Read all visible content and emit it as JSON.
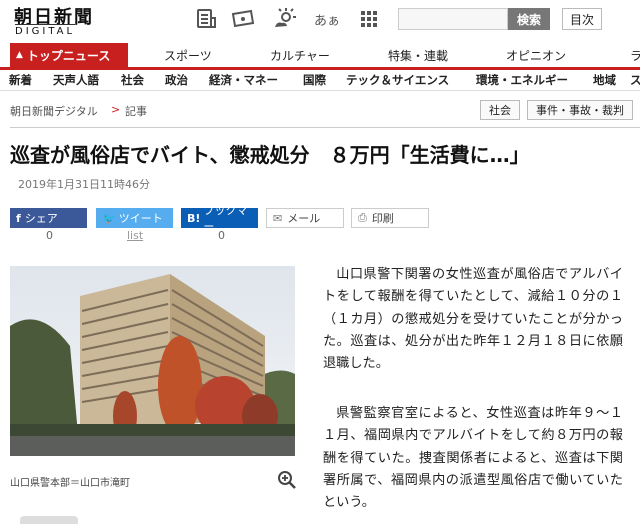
{
  "header": {
    "logo_main": "朝日新聞",
    "logo_sub": "DIGITAL",
    "search_placeholder": "",
    "search_label": "検索",
    "toc_label": "目次",
    "font_size_label": "あぁ"
  },
  "nav_primary": [
    {
      "label": "トップニュース",
      "active": true
    },
    {
      "label": "スポーツ"
    },
    {
      "label": "カルチャー"
    },
    {
      "label": "特集・連載"
    },
    {
      "label": "オピニオン"
    },
    {
      "label": "ラ"
    }
  ],
  "nav_secondary": [
    "新着",
    "天声人語",
    "社会",
    "政治",
    "経済・マネー",
    "国際",
    "テック＆サイエンス",
    "環境・エネルギー",
    "地域",
    "ス"
  ],
  "breadcrumb": {
    "home": "朝日新聞デジタル",
    "separator": ">",
    "current": "記事"
  },
  "tags": [
    "社会",
    "事件・事故・裁判"
  ],
  "article": {
    "title": "巡査が風俗店でバイト、懲戒処分　８万円「生活費に…」",
    "date": "2019年1月31日11時46分",
    "caption": "山口県警本部＝山口市滝町",
    "paragraphs": [
      "山口県警下関署の女性巡査が風俗店でアルバイトをして報酬を得ていたとして、減給１０分の１（１カ月）の懲戒処分を受けていたことが分かった。巡査は、処分が出た昨年１２月１８日に依願退職した。",
      "県警監察官室によると、女性巡査は昨年９～１１月、福岡県内でアルバイトをして約８万円の報酬を得ていた。捜査関係者によると、巡査は下関署所属で、福岡県内の派遣型風俗店で働いていたという。"
    ]
  },
  "share": [
    {
      "label": "シェア",
      "count": "0",
      "color": "#3b5998"
    },
    {
      "label": "ツイート",
      "count": "list",
      "color": "#55acee"
    },
    {
      "label": "ブックマー",
      "count": "0",
      "color": "#0b5eb5"
    },
    {
      "label": "メール",
      "count": ""
    },
    {
      "label": "印刷",
      "count": ""
    }
  ]
}
